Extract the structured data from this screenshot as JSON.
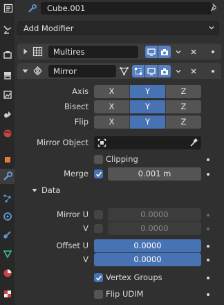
{
  "header": {
    "object_name": "Cube.001"
  },
  "add_modifier": {
    "label": "Add Modifier"
  },
  "modifiers": [
    {
      "name": "Multires",
      "expanded": false
    },
    {
      "name": "Mirror",
      "expanded": true
    }
  ],
  "mirror": {
    "axis": {
      "label": "Axis",
      "options": [
        "X",
        "Y",
        "Z"
      ],
      "active": "Y"
    },
    "bisect": {
      "label": "Bisect",
      "options": [
        "X",
        "Y",
        "Z"
      ],
      "active": "Y"
    },
    "flip": {
      "label": "Flip",
      "options": [
        "X",
        "Y",
        "Z"
      ],
      "active": "Y"
    },
    "mirror_object": {
      "label": "Mirror Object",
      "value": ""
    },
    "clipping": {
      "label": "Clipping",
      "checked": false
    },
    "merge": {
      "label": "Merge",
      "checked": true,
      "value": "0.001 m"
    },
    "data_section": {
      "label": "Data",
      "expanded": true
    },
    "mirror_u": {
      "label": "Mirror U",
      "checked": false,
      "value": "0.0000"
    },
    "mirror_v": {
      "label": "V",
      "checked": false,
      "value": "0.0000"
    },
    "offset_u": {
      "label": "Offset U",
      "value": "0.0000"
    },
    "offset_v": {
      "label": "V",
      "value": "0.0000"
    },
    "vertex_groups": {
      "label": "Vertex Groups",
      "checked": true
    },
    "flip_udim": {
      "label": "Flip UDIM",
      "checked": false
    }
  },
  "colors": {
    "accent": "#4772b3",
    "panel_bg": "#303030",
    "header_bg": "#3d3d3d"
  },
  "icons": {
    "tabs": [
      "tool-icon",
      "render-icon",
      "output-icon",
      "view-layer-icon",
      "scene-icon",
      "world-icon",
      "object-icon",
      "modifier-icon",
      "particles-icon",
      "physics-icon",
      "constraints-icon",
      "data-icon",
      "material-icon",
      "texture-icon"
    ]
  }
}
